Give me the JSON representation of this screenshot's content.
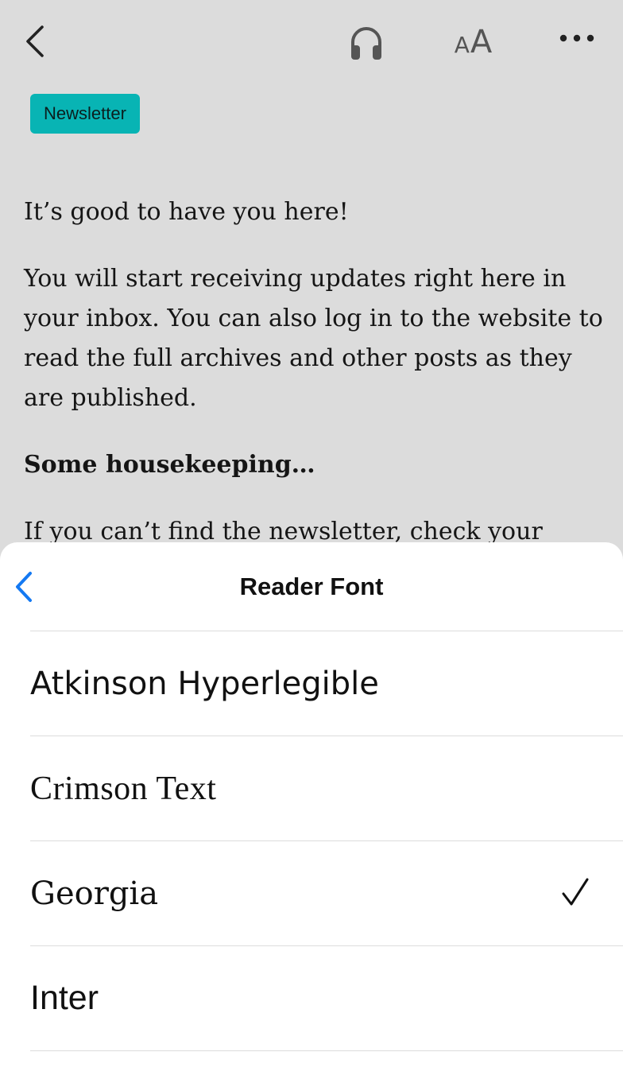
{
  "topbar": {
    "back_icon": "chevron-left-icon",
    "listen_icon": "headphones-icon",
    "text_size": {
      "small": "A",
      "large": "A"
    },
    "more_icon": "more-horizontal-icon"
  },
  "article": {
    "badge": "Newsletter",
    "paragraphs": [
      "It’s good to have you here!",
      "You will start receiving updates right here in your inbox. You can also log in to the website to read the full archives and other posts as they are published.",
      "Some housekeeping…",
      "If you can’t find the newsletter, check your"
    ]
  },
  "sheet": {
    "title": "Reader Font",
    "fonts": [
      {
        "label": "Atkinson Hyperlegible",
        "selected": false
      },
      {
        "label": "Crimson Text",
        "selected": false
      },
      {
        "label": "Georgia",
        "selected": true
      },
      {
        "label": "Inter",
        "selected": false
      }
    ]
  },
  "colors": {
    "background": "#dcdcdc",
    "badge": "#08b4b4",
    "accent": "#1479f2",
    "sheet": "#ffffff"
  }
}
